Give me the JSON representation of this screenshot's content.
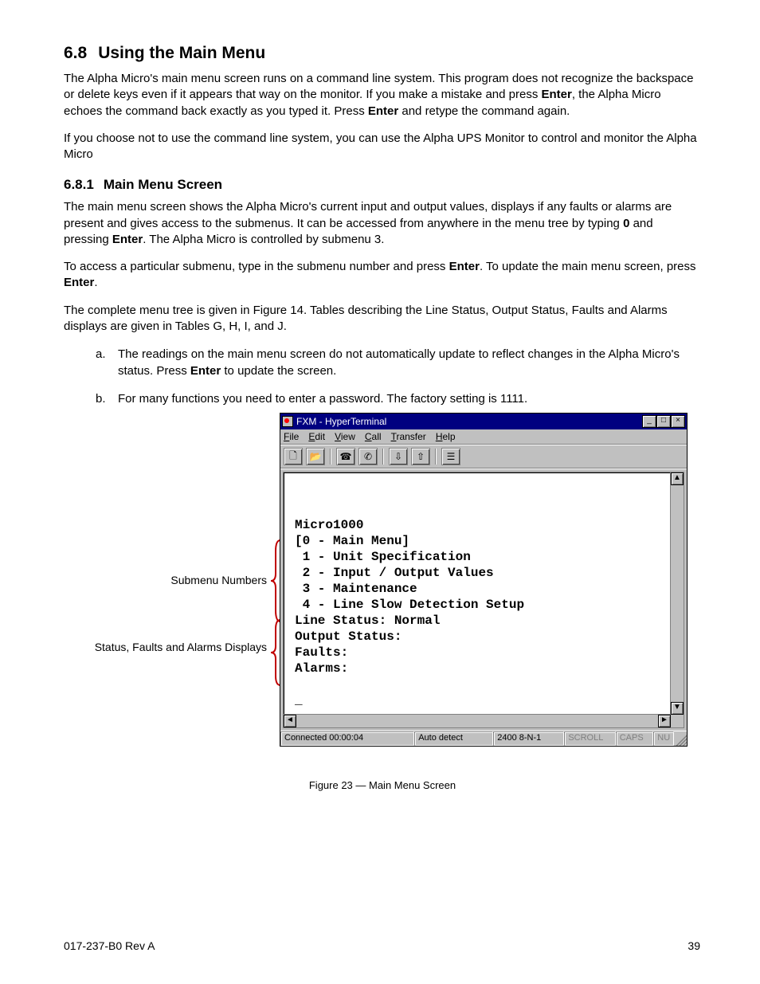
{
  "section": {
    "num": "6.8",
    "title": "Using the Main Menu"
  },
  "para1_a": "The Alpha Micro's main menu screen runs on a command line system. This program does not recognize the backspace or delete keys even if it appears that way on the monitor. If you make a mistake and press ",
  "para1_b": ", the Alpha Micro echoes the command back exactly as you typed it. Press ",
  "para1_c": " and retype the command again.",
  "para2": "If you choose not to use the command line system, you can use the Alpha UPS Monitor to control and monitor the Alpha Micro",
  "subsection": {
    "num": "6.8.1",
    "title": "Main Menu Screen"
  },
  "para3_a": "The main menu screen shows the Alpha Micro's current input and output values, displays if any faults or alarms are present and gives access to the submenus. It can be accessed from anywhere in the menu tree by typing ",
  "para3_b": " and pressing ",
  "para3_c": ". The Alpha Micro is controlled by submenu 3.",
  "para4_a": "To access a particular submenu, type in the submenu number and press ",
  "para4_b": ". To update the main menu screen, press ",
  "para4_c": ".",
  "para5": "The complete menu tree is given in Figure 14. Tables describing the Line Status, Output Status, Faults and Alarms displays are given in Tables G, H, I, and J.",
  "bold": {
    "enter": "Enter",
    "zero": "0"
  },
  "list": {
    "a_marker": "a.",
    "a_1": "The readings on the main menu screen do not automatically update to reflect changes in the Alpha Micro's status. Press ",
    "a_2": " to update the screen.",
    "b_marker": "b.",
    "b": "For many functions you need to enter a password. The factory setting is 1111."
  },
  "annot": {
    "submenu": "Submenu Numbers",
    "status": "Status, Faults and Alarms Displays"
  },
  "ht": {
    "title": "FXM - HyperTerminal",
    "menu": {
      "file": "File",
      "edit": "Edit",
      "view": "View",
      "call": "Call",
      "transfer": "Transfer",
      "help": "Help"
    },
    "status": {
      "connected": "Connected 00:00:04",
      "autodetect": "Auto detect",
      "line": "2400 8-N-1",
      "scroll": "SCROLL",
      "caps": "CAPS",
      "num": "NU"
    }
  },
  "terminal": {
    "l0": "Micro1000",
    "l1": "[0 - Main Menu]",
    "l2": " 1 - Unit Specification",
    "l3": " 2 - Input / Output Values",
    "l4": " 3 - Maintenance",
    "l5": " 4 - Line Slow Detection Setup",
    "l6": "Line Status: Normal",
    "l7": "Output Status:",
    "l8": "Faults:",
    "l9": "Alarms:",
    "l10": "",
    "l11": "_"
  },
  "caption": "Figure 23  —  Main Menu Screen",
  "footer": {
    "left": "017-237-B0    Rev A",
    "right": "39"
  }
}
